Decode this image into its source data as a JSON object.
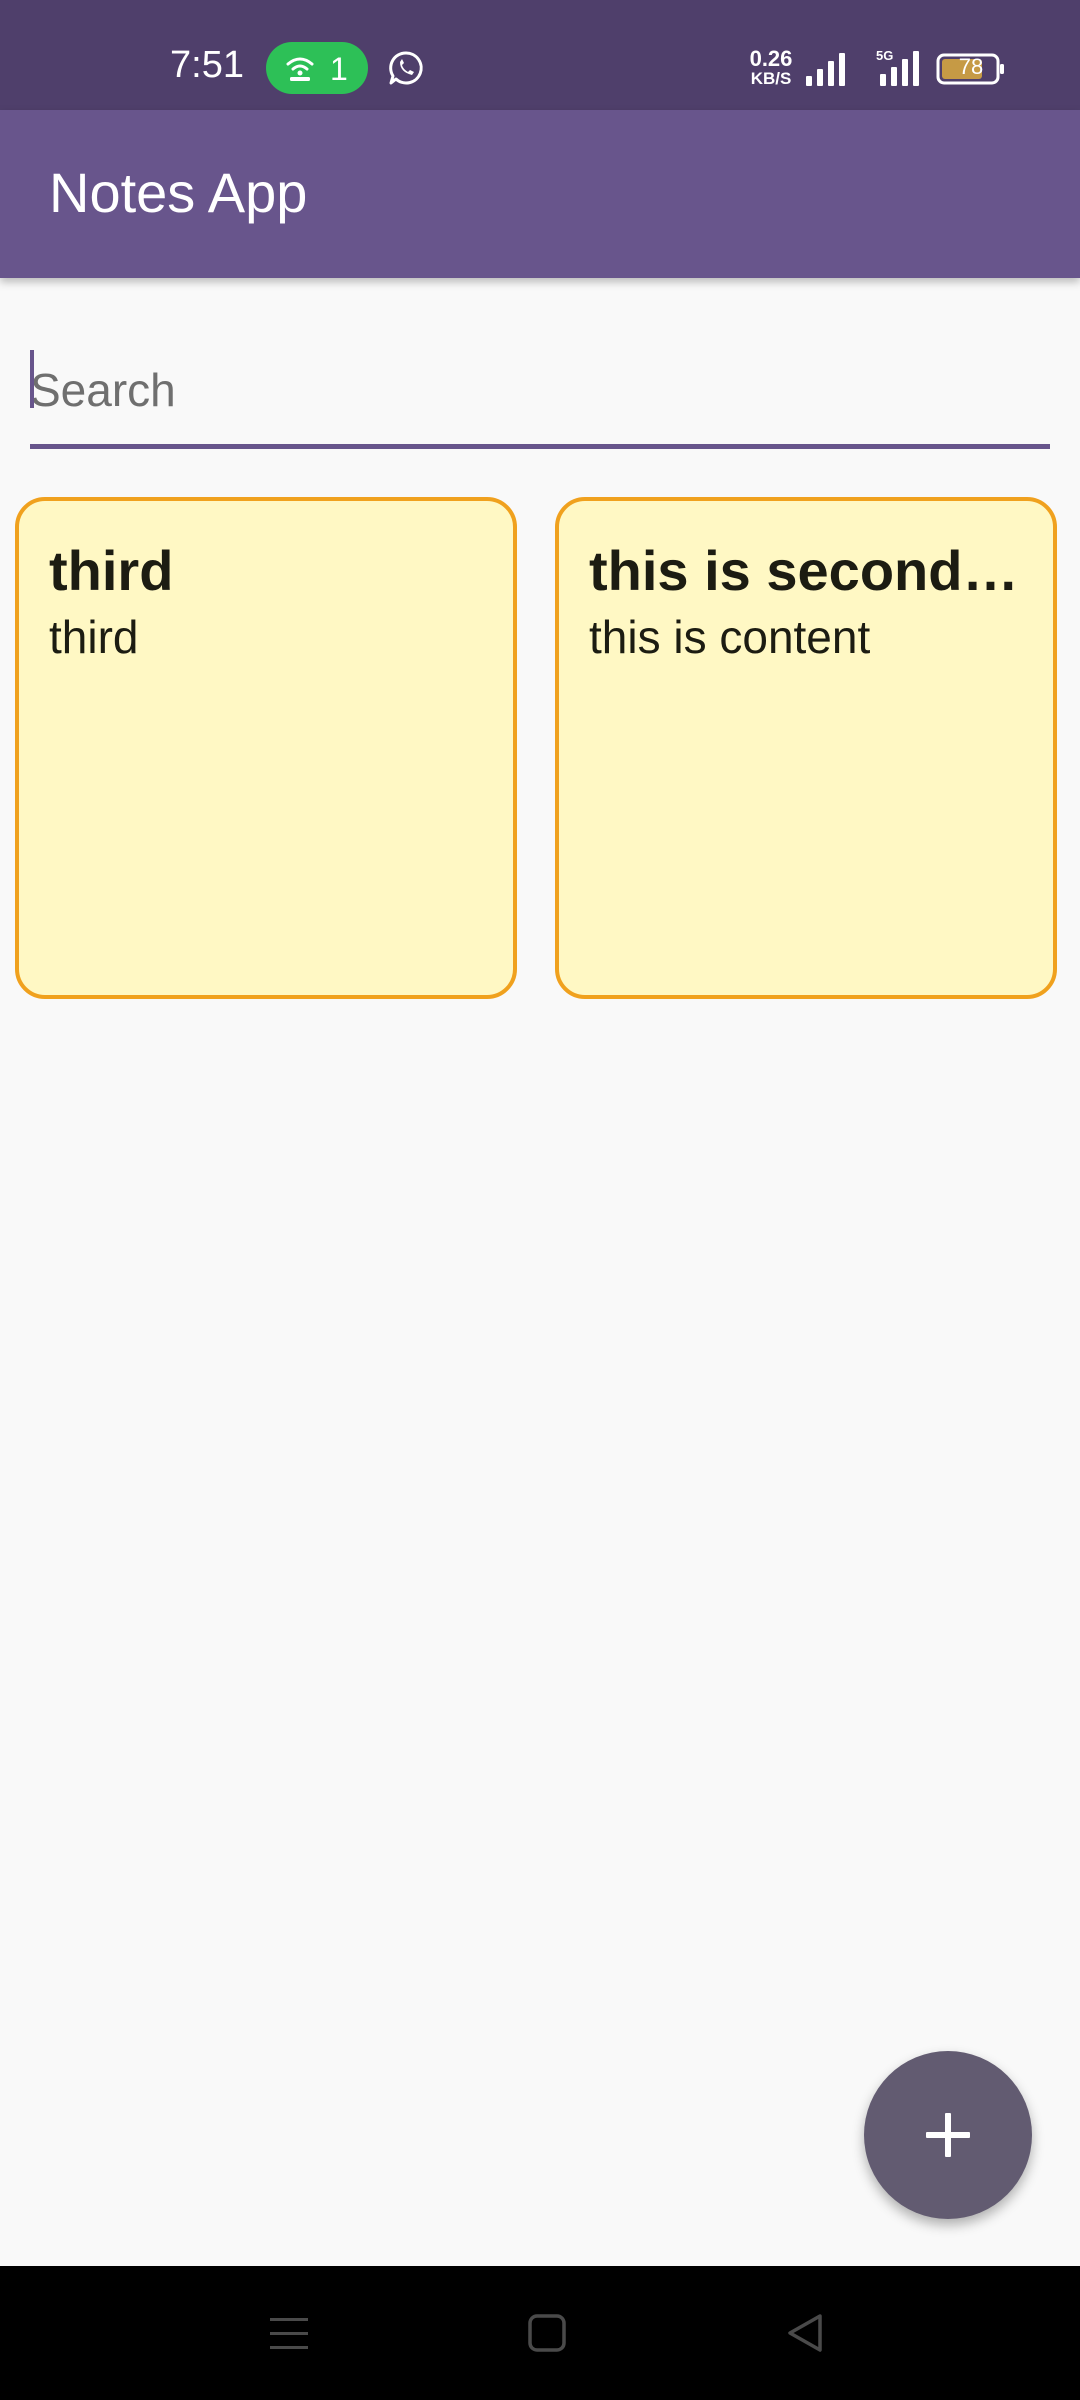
{
  "status_bar": {
    "time": "7:51",
    "hotspot_count": "1",
    "net_speed_value": "0.26",
    "net_speed_unit": "KB/S",
    "network_type": "5G",
    "battery": "78",
    "icons": [
      "hotspot-icon",
      "whatsapp-icon",
      "signal-icon",
      "battery-icon"
    ]
  },
  "app_bar": {
    "title": "Notes App"
  },
  "search": {
    "placeholder": "Search",
    "value": ""
  },
  "notes": [
    {
      "title": "third",
      "content": "third"
    },
    {
      "title": "this is second …",
      "content": "this is content"
    }
  ],
  "fab": {
    "icon": "plus-icon"
  },
  "nav_bar": {
    "icons": [
      "menu-icon",
      "home-icon",
      "back-icon"
    ]
  },
  "colors": {
    "status_bar": "#4f3f6b",
    "app_bar": "#68558c",
    "background": "#f9f9f9",
    "note_fill": "#fff8c4",
    "note_border": "#f0a11e",
    "fab": "#625b71",
    "hotspot_pill": "#2dc057"
  }
}
